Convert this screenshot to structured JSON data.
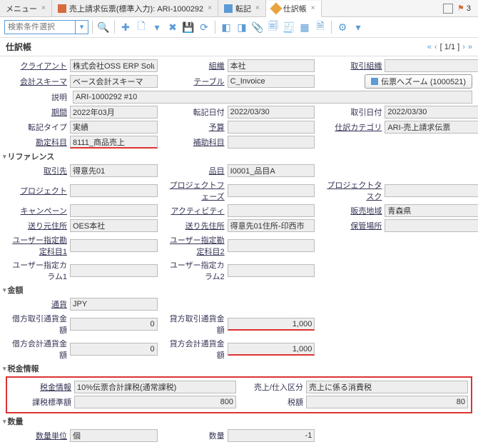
{
  "tabs": [
    "メニュー",
    "売上請求伝票(標準入力): ARI-1000292",
    "転記",
    "仕訳帳"
  ],
  "active_tab": 3,
  "notif_count": "3",
  "search_combo_placeholder": "検索条件選択",
  "page_title": "仕訳帳",
  "pager": "[ 1/1 ]",
  "sections": {
    "reference": "リファレンス",
    "amount": "金額",
    "tax": "税金情報",
    "qty": "数量"
  },
  "labels": {
    "client": "クライアント",
    "org": "組織",
    "trx_org": "取引組織",
    "schema": "会計スキーマ",
    "table": "テーブル",
    "desc": "説明",
    "period": "期間",
    "date_acct": "転記日付",
    "date_trx": "取引日付",
    "posting_type": "転記タイプ",
    "budget": "予算",
    "journal_cat": "仕訳カテゴリ",
    "account": "勘定科目",
    "sub_account": "補助科目",
    "bp": "取引先",
    "product": "品目",
    "sales_region": "販売地域",
    "project": "プロジェクト",
    "project_phase": "プロジェクトフェーズ",
    "project_task": "プロジェクトタスク",
    "campaign": "キャンペーン",
    "activity": "アクティビティ",
    "loc_from": "送り元住所",
    "loc_to": "送り先住所",
    "warehouse": "保管場所",
    "user1": "ユーザー指定勘定科目1",
    "user_col1": "ユーザー指定カラム1",
    "user2": "ユーザー指定勘定科目2",
    "user_col2": "ユーザー指定カラム2",
    "currency": "通貨",
    "dr_src": "借方取引通貨金額",
    "cr_src": "貸方取引通貨金額",
    "dr_acct": "借方会計通貨金額",
    "cr_acct": "貸方会計通貨金額",
    "tax_info": "税金情報",
    "sotrx": "売上/仕入区分",
    "tax_base": "課税標準額",
    "tax_amt": "税額",
    "uom": "数量単位",
    "qty": "数量"
  },
  "values": {
    "client": "株式会社OSS ERP Solutions",
    "org": "本社",
    "trx_org": "",
    "schema": "ベース会計スキーマ",
    "table": "C_Invoice",
    "zoom_btn": "伝票へズーム (1000521)",
    "desc": "ARI-1000292 #10",
    "period": "2022年03月",
    "date_acct": "2022/03/30",
    "date_trx": "2022/03/30",
    "posting_type": "実績",
    "budget": "",
    "journal_cat": "ARI-売上請求伝票",
    "account": "8111_商品売上",
    "sub_account": "",
    "bp": "得意先01",
    "product": "I0001_品目A",
    "sales_region": "青森県",
    "project": "",
    "project_phase": "",
    "project_task": "",
    "campaign": "",
    "activity": "",
    "loc_from": "OES本社",
    "loc_to": "得意先01住所-印西市",
    "warehouse": "",
    "user1": "",
    "user_col1": "",
    "user2": "",
    "user_col2": "",
    "currency": "JPY",
    "dr_src": "0",
    "cr_src": "1,000",
    "dr_acct": "0",
    "cr_acct": "1,000",
    "tax_info": "10%伝票合計課税(通常課税)",
    "sotrx": "売上に係る消費税",
    "tax_base": "800",
    "tax_amt": "80",
    "uom": "個",
    "qty": "-1"
  }
}
